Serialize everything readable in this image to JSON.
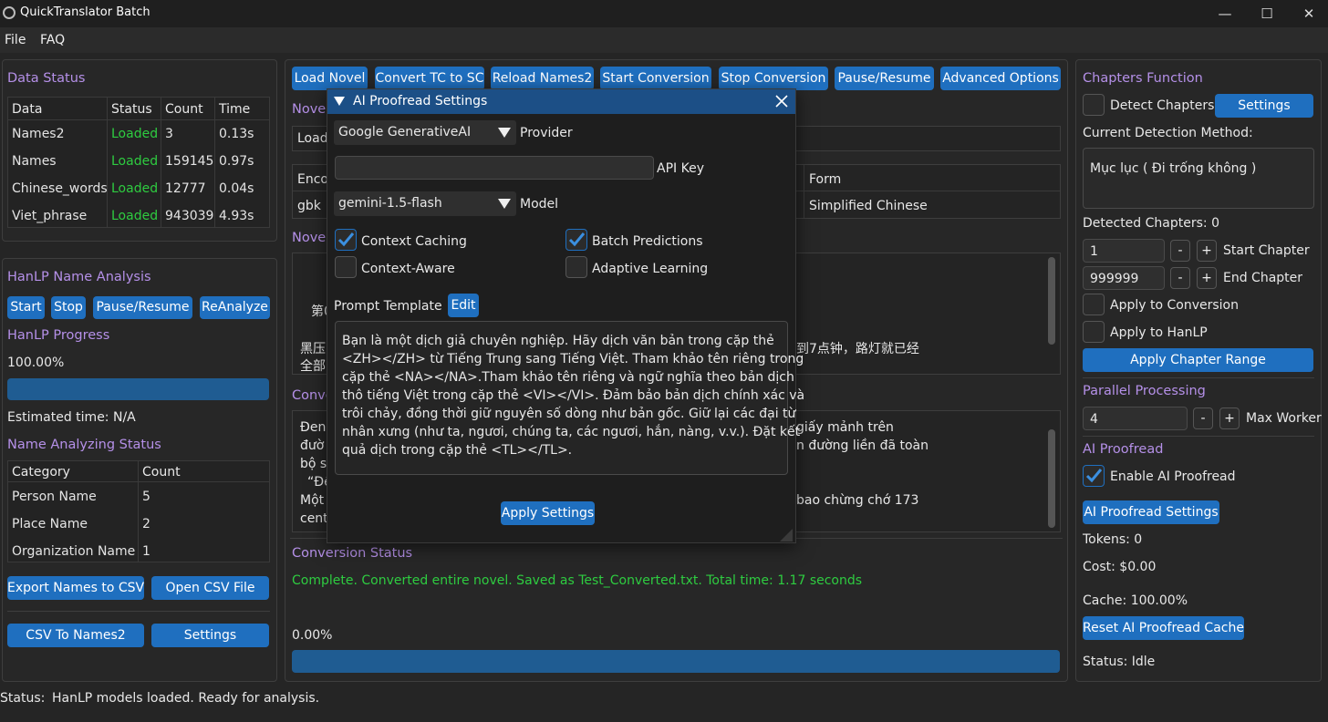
{
  "window": {
    "title": "QuickTranslator Batch",
    "minimize": "—",
    "maximize": "☐",
    "close": "✕"
  },
  "menu": {
    "file": "File",
    "faq": "FAQ"
  },
  "data_status": {
    "title": "Data Status",
    "headers": [
      "Data",
      "Status",
      "Count",
      "Time"
    ],
    "rows": [
      {
        "data": "Names2",
        "status": "Loaded",
        "count": "3",
        "time": "0.13s"
      },
      {
        "data": "Names",
        "status": "Loaded",
        "count": "159145",
        "time": "0.97s"
      },
      {
        "data": "Chinese_words",
        "status": "Loaded",
        "count": "12777",
        "time": "0.04s"
      },
      {
        "data": "Viet_phrase",
        "status": "Loaded",
        "count": "943039",
        "time": "4.93s"
      }
    ]
  },
  "hanlp": {
    "title": "HanLP Name Analysis",
    "buttons": {
      "start": "Start",
      "stop": "Stop",
      "pause": "Pause/Resume",
      "reanalyze": "ReAnalyze"
    },
    "progress_title": "HanLP Progress",
    "progress_value": "100.00%",
    "progress_fraction": 1.0,
    "estimated": "Estimated time: N/A",
    "status_title": "Name Analyzing Status",
    "headers": [
      "Category",
      "Count"
    ],
    "rows": [
      {
        "category": "Person Name",
        "count": "5"
      },
      {
        "category": "Place Name",
        "count": "2"
      },
      {
        "category": "Organization Name",
        "count": "1"
      }
    ],
    "export_btn": "Export Names to CSV",
    "open_btn": "Open CSV File",
    "csv_btn": "CSV To Names2",
    "settings_btn": "Settings"
  },
  "toolbar": {
    "load": "Load Novel",
    "convert": "Convert TC to SC",
    "reload": "Reload Names2",
    "start": "Start Conversion",
    "stop": "Stop Conversion",
    "pause": "Pause/Resume",
    "advanced": "Advanced Options"
  },
  "center": {
    "novel_label": "Novel",
    "load_label": "Load",
    "enco_label": "Enco",
    "enco_value": "gbk",
    "form_label": "Form",
    "form_value": "Simplified Chinese",
    "novel2_label": "Novel",
    "orig_frag1": "第0",
    "orig_frag2": "黑压",
    "orig_frag3": "全部",
    "orig_right": "到7点钟，路灯就已经",
    "conv_label": "Conve",
    "conv_l1": "Đen",
    "conv_l2": "đườ",
    "conv_l3": "bộ s",
    "conv_l4": "“Đê",
    "conv_l5": "Một",
    "conv_l6": "cent",
    "conv_r1": "giấy mảnh trên",
    "conv_r2": "n đường liền đã toàn",
    "conv_r3": "bao chừng chớ 173",
    "status_title": "Conversion Status",
    "status_text": "Complete. Converted entire novel. Saved as Test_Converted.txt. Total time: 1.17 seconds",
    "progress_value": "0.00%",
    "progress_fraction": 0.0
  },
  "dialog": {
    "title": "AI Proofread Settings",
    "provider_value": "Google GenerativeAI",
    "provider_label": "Provider",
    "api_key_value": "",
    "api_key_label": "API Key",
    "model_value": "gemini-1.5-flash",
    "model_label": "Model",
    "context_caching": "Context Caching",
    "batch_predictions": "Batch Predictions",
    "context_aware": "Context-Aware",
    "adaptive_learning": "Adaptive Learning",
    "prompt_label": "Prompt Template",
    "edit_btn": "Edit",
    "prompt_lines": [
      "Bạn là một dịch giả chuyên nghiệp. Hãy dịch văn bản trong cặp thẻ",
      "<ZH></ZH> từ Tiếng Trung sang Tiếng Việt. Tham khảo tên riêng trong",
      "cặp thẻ <NA></NA>.Tham khảo tên riêng và ngữ nghĩa theo bản dịch",
      "thô tiếng Việt trong cặp thẻ <VI></VI>. Đảm bảo bản dịch chính xác và",
      "trôi chảy, đồng thời giữ nguyên số dòng như bản gốc. Giữ lại các đại từ",
      "nhân xưng (như ta, ngươi, chúng ta, các ngươi, hắn, nàng, v.v.). Đặt kết",
      "quả dịch trong cặp thẻ <TL></TL>."
    ],
    "apply_btn": "Apply Settings"
  },
  "chapters": {
    "title": "Chapters Function",
    "detect_label": "Detect Chapters",
    "settings_btn": "Settings",
    "method_label": "Current Detection Method:",
    "method_value": "Mục lục ( Đi trống không )",
    "detected": "Detected Chapters: 0",
    "start_value": "1",
    "start_label": "Start Chapter",
    "end_value": "999999",
    "end_label": "End Chapter",
    "minus": "-",
    "plus": "+",
    "apply_conversion": "Apply to Conversion",
    "apply_hanlp": "Apply to HanLP",
    "apply_range_btn": "Apply Chapter Range"
  },
  "parallel": {
    "title": "Parallel Processing",
    "value": "4",
    "label": "Max Worker"
  },
  "ai": {
    "title": "AI Proofread",
    "enable_label": "Enable AI Proofread",
    "settings_btn": "AI Proofread Settings",
    "tokens": "Tokens: 0",
    "cost": "Cost: $0.00",
    "cache": "Cache: 100.00%",
    "reset_btn": "Reset AI Proofread Cache",
    "status": "Status: Idle"
  },
  "statusbar": {
    "label": "Status:",
    "text": "HanLP models loaded. Ready for analysis."
  }
}
